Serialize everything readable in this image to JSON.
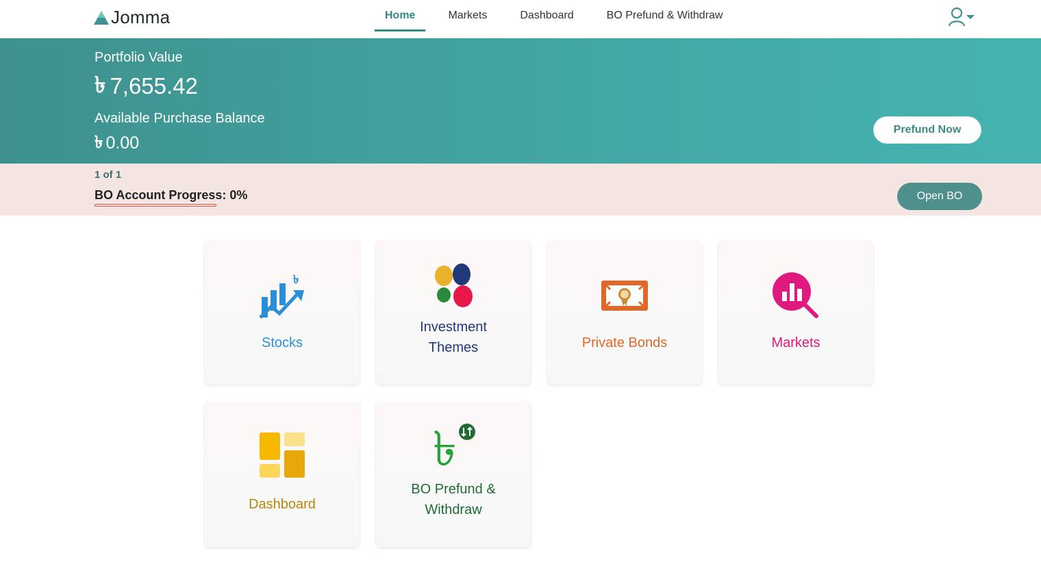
{
  "app": {
    "name": "Jomma"
  },
  "nav": {
    "items": [
      {
        "label": "Home",
        "active": true
      },
      {
        "label": "Markets",
        "active": false
      },
      {
        "label": "Dashboard",
        "active": false
      },
      {
        "label": "BO Prefund & Withdraw",
        "active": false
      }
    ],
    "user_icon": "user-icon",
    "dropdown_icon": "caret-down-icon"
  },
  "portfolio": {
    "label": "Portfolio Value",
    "currency": "৳",
    "value": "7,655.42",
    "balance_label": "Available Purchase Balance",
    "balance_value": "0.00",
    "prefund_button": "Prefund Now"
  },
  "bo": {
    "pager": "1 of 1",
    "progress_label": "BO Account Progress",
    "progress_value": ": 0%",
    "progress_percent": 0,
    "open_button": "Open BO"
  },
  "cards": [
    {
      "label": "Stocks",
      "color": "#2a8fd8",
      "icon": "stocks-chart-icon"
    },
    {
      "label": "Investment Themes",
      "color": "#233a7a",
      "icon": "petals-icon"
    },
    {
      "label": "Private Bonds",
      "color": "#e2682a",
      "icon": "bond-certificate-icon"
    },
    {
      "label": "Markets",
      "color": "#e0197e",
      "icon": "market-search-icon"
    },
    {
      "label": "Dashboard",
      "color": "#b8860b",
      "icon": "dashboard-tiles-icon"
    },
    {
      "label": "BO Prefund & Withdraw",
      "color": "#1f6b34",
      "icon": "taka-transfer-icon"
    }
  ],
  "colors": {
    "primary": "#3e918e",
    "bo_strip": "#f5e5e2"
  }
}
